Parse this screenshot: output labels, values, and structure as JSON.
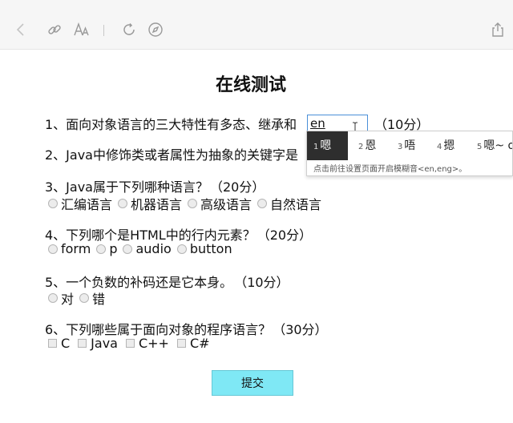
{
  "quiz": {
    "title": "在线测试",
    "q1": {
      "text": "1、面向对象语言的三大特性有多态、继承和",
      "input_value": "en",
      "score": "（10分）"
    },
    "q2": {
      "text": "2、Java中修饰类或者属性为抽象的关键字是"
    },
    "q3": {
      "text": "3、Java属于下列哪种语言？",
      "score": "（20分）",
      "options": [
        "汇编语言",
        "机器语言",
        "高级语言",
        "自然语言"
      ]
    },
    "q4": {
      "text": "4、下列哪个是HTML中的行内元素？",
      "score": "（20分）",
      "options": [
        "form",
        "p",
        "audio",
        "button"
      ]
    },
    "q5": {
      "text": "5、一个负数的补码还是它本身。",
      "score": "（10分）",
      "options": [
        "对",
        "错"
      ]
    },
    "q6": {
      "text": "6、下列哪些属于面向对象的程序语言？",
      "score": "（30分）",
      "options": [
        "C",
        "Java",
        "C++",
        "C#"
      ]
    },
    "submit_label": "提交"
  },
  "ime": {
    "candidates": [
      {
        "num": "1",
        "text": "嗯"
      },
      {
        "num": "2",
        "text": "恩"
      },
      {
        "num": "3",
        "text": "唔"
      },
      {
        "num": "4",
        "text": "摁"
      },
      {
        "num": "5",
        "text": "嗯~ o"
      }
    ],
    "hint": "点击前往设置页面开启模糊音<en,eng>。"
  },
  "toolbar": {
    "icons": [
      "back-icon",
      "link-icon",
      "text-size-icon",
      "refresh-icon",
      "compass-icon",
      "share-icon"
    ]
  }
}
